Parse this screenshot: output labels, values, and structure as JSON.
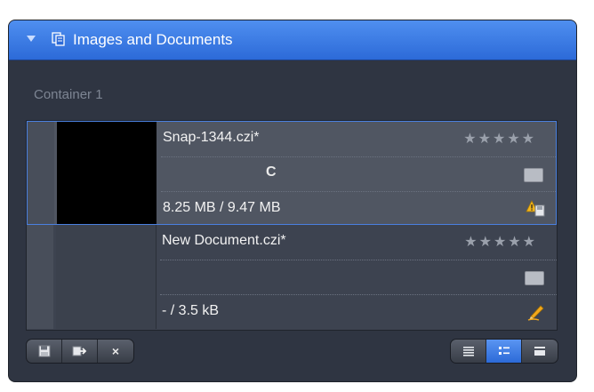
{
  "panel": {
    "title": "Images and Documents",
    "container_label": "Container 1",
    "colors": {
      "header": "#2c6ad8",
      "selection": "#4a80e0",
      "background": "#2f3542"
    }
  },
  "documents": [
    {
      "name": "Snap-1344.czi*",
      "status": "C",
      "size": "8.25 MB / 9.47 MB",
      "rating": "★★★★★",
      "selected": true,
      "icon": "warning-save-icon"
    },
    {
      "name": "New Document.czi*",
      "status": "",
      "size": "- / 3.5 kB",
      "rating": "★★★★★",
      "selected": false,
      "icon": "pencil-edit-icon"
    }
  ],
  "toolbar": {
    "left_buttons": [
      "save-icon",
      "export-icon",
      "close-x-icon"
    ],
    "close_label": "×",
    "view_buttons": [
      "list-view-icon",
      "detail-view-icon",
      "large-view-icon"
    ],
    "active_view": "detail-view-icon"
  }
}
